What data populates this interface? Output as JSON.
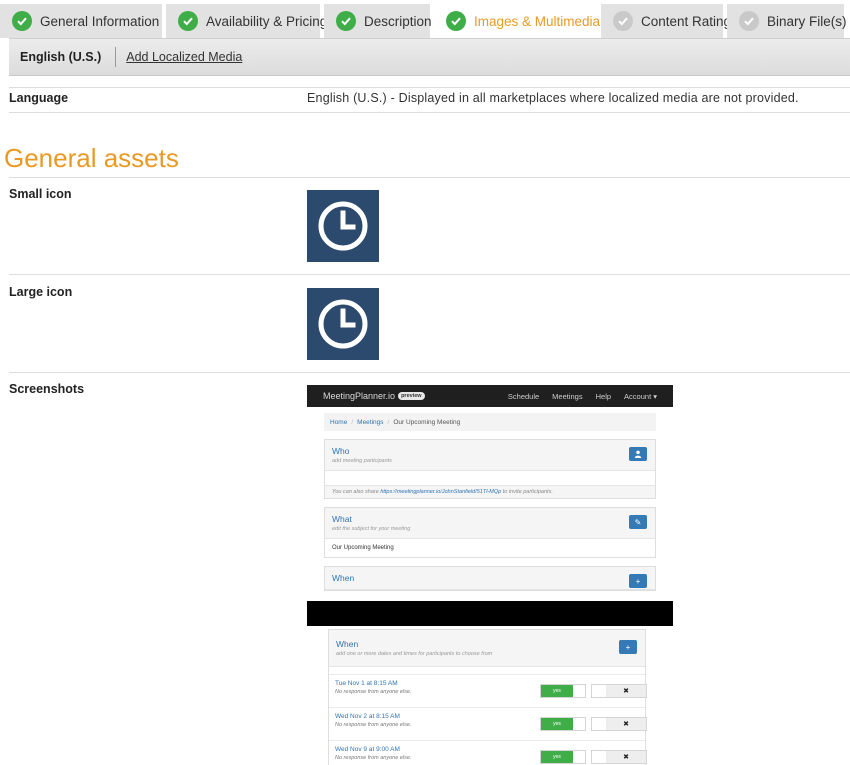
{
  "tabs": [
    {
      "label": "General Information",
      "status": "complete"
    },
    {
      "label": "Availability & Pricing",
      "status": "complete"
    },
    {
      "label": "Description",
      "status": "complete"
    },
    {
      "label": "Images & Multimedia",
      "status": "complete",
      "active": true
    },
    {
      "label": "Content Rating",
      "status": "pending"
    },
    {
      "label": "Binary File(s)",
      "status": "pending"
    }
  ],
  "subbar": {
    "current_locale": "English (U.S.)",
    "add_link": "Add Localized Media"
  },
  "language": {
    "label": "Language",
    "value": "English (U.S.) - Displayed in all marketplaces where localized media are not provided."
  },
  "general_assets": {
    "title": "General assets",
    "small_icon_label": "Small icon",
    "large_icon_label": "Large icon",
    "screenshots_label": "Screenshots"
  },
  "screenshot1": {
    "brand": "MeetingPlanner.io",
    "badge": "preview",
    "nav": [
      "Schedule",
      "Meetings",
      "Help",
      "Account ▾"
    ],
    "breadcrumb": [
      "Home",
      "Meetings",
      "Our Upcoming Meeting"
    ],
    "who": {
      "title": "Who",
      "subtitle": "add meeting participants",
      "share_prefix": "You can also share ",
      "share_link": "https://meetingplanner.io/JohnStanfield/51Tl-MQp",
      "share_suffix": " to invite participants."
    },
    "what": {
      "title": "What",
      "subtitle": "edit the subject for your meeting",
      "body": "Our Upcoming Meeting"
    },
    "when_partial": "When"
  },
  "screenshot2": {
    "title": "When",
    "subtitle": "add one or more dates and times for participants to choose from",
    "yes_label": "yes",
    "no_label": "✖",
    "rows": [
      {
        "date": "Tue Nov 1 at 8:15 AM",
        "note": "No response from anyone else."
      },
      {
        "date": "Wed Nov 2 at 8:15 AM",
        "note": "No response from anyone else."
      },
      {
        "date": "Wed Nov 9 at 9:00 AM",
        "note": "No response from anyone else."
      }
    ]
  },
  "colors": {
    "accent": "#e89a24",
    "check_ok": "#3fae49",
    "check_pending": "#c9c9c9",
    "icon_bg": "#2b4a6e"
  }
}
